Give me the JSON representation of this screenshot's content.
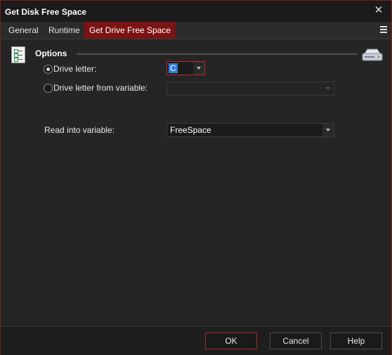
{
  "window": {
    "title": "Get Disk Free Space"
  },
  "tabs": [
    {
      "label": "General"
    },
    {
      "label": "Runtime"
    },
    {
      "label": "Get Drive Free Space"
    }
  ],
  "options": {
    "section_title": "Options",
    "drive_letter": {
      "label": "Drive letter:",
      "value": "C",
      "selected": true
    },
    "drive_letter_from_variable": {
      "label": "Drive letter from variable:",
      "value": "",
      "selected": false
    },
    "read_into_variable": {
      "label": "Read into variable:",
      "value": "FreeSpace"
    }
  },
  "buttons": {
    "ok": "OK",
    "cancel": "Cancel",
    "help": "Help"
  },
  "colors": {
    "accent": "#7b1213",
    "background": "#252526",
    "selection": "#2f7ed8"
  }
}
